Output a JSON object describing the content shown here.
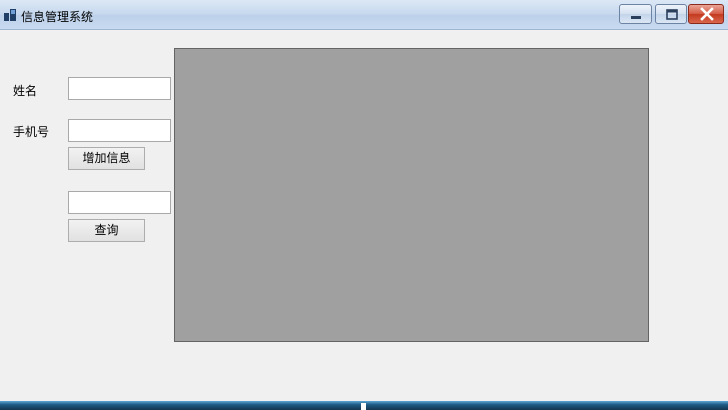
{
  "window": {
    "title": "信息管理系统",
    "controls": [
      "minimize-icon",
      "maximize-icon",
      "close-icon"
    ]
  },
  "form": {
    "name_label": "姓名",
    "name_value": "",
    "phone_label": "手机号",
    "phone_value": "",
    "add_button_label": "增加信息",
    "query_value": "",
    "query_button_label": "查询"
  },
  "data_grid": {
    "rows": []
  },
  "colors": {
    "grid_background": "#a0a0a0",
    "window_background": "#f0f0f0",
    "close_button": "#c3391f"
  }
}
